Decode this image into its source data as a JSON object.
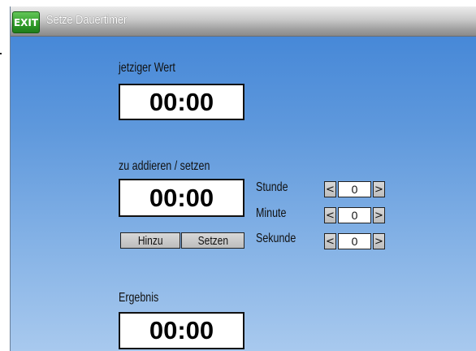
{
  "titlebar": {
    "exit_label": "EXIT",
    "title": "Setze Dauertimer"
  },
  "current": {
    "label": "jetziger Wert",
    "value": "00:00"
  },
  "adjust": {
    "label": "zu addieren / setzen",
    "value": "00:00",
    "add_button": "Hinzu",
    "set_button": "Setzen"
  },
  "fields": [
    {
      "label": "Stunde",
      "value": "0",
      "dec": "<",
      "inc": ">"
    },
    {
      "label": "Minute",
      "value": "0",
      "dec": "<",
      "inc": ">"
    },
    {
      "label": "Sekunde",
      "value": "0",
      "dec": "<",
      "inc": ">"
    }
  ],
  "result": {
    "label": "Ergebnis",
    "value": "00:00"
  },
  "colors": {
    "background_top": "#3f83d6",
    "background_bottom": "#a8c9ee",
    "exit_green": "#2f9a28"
  }
}
